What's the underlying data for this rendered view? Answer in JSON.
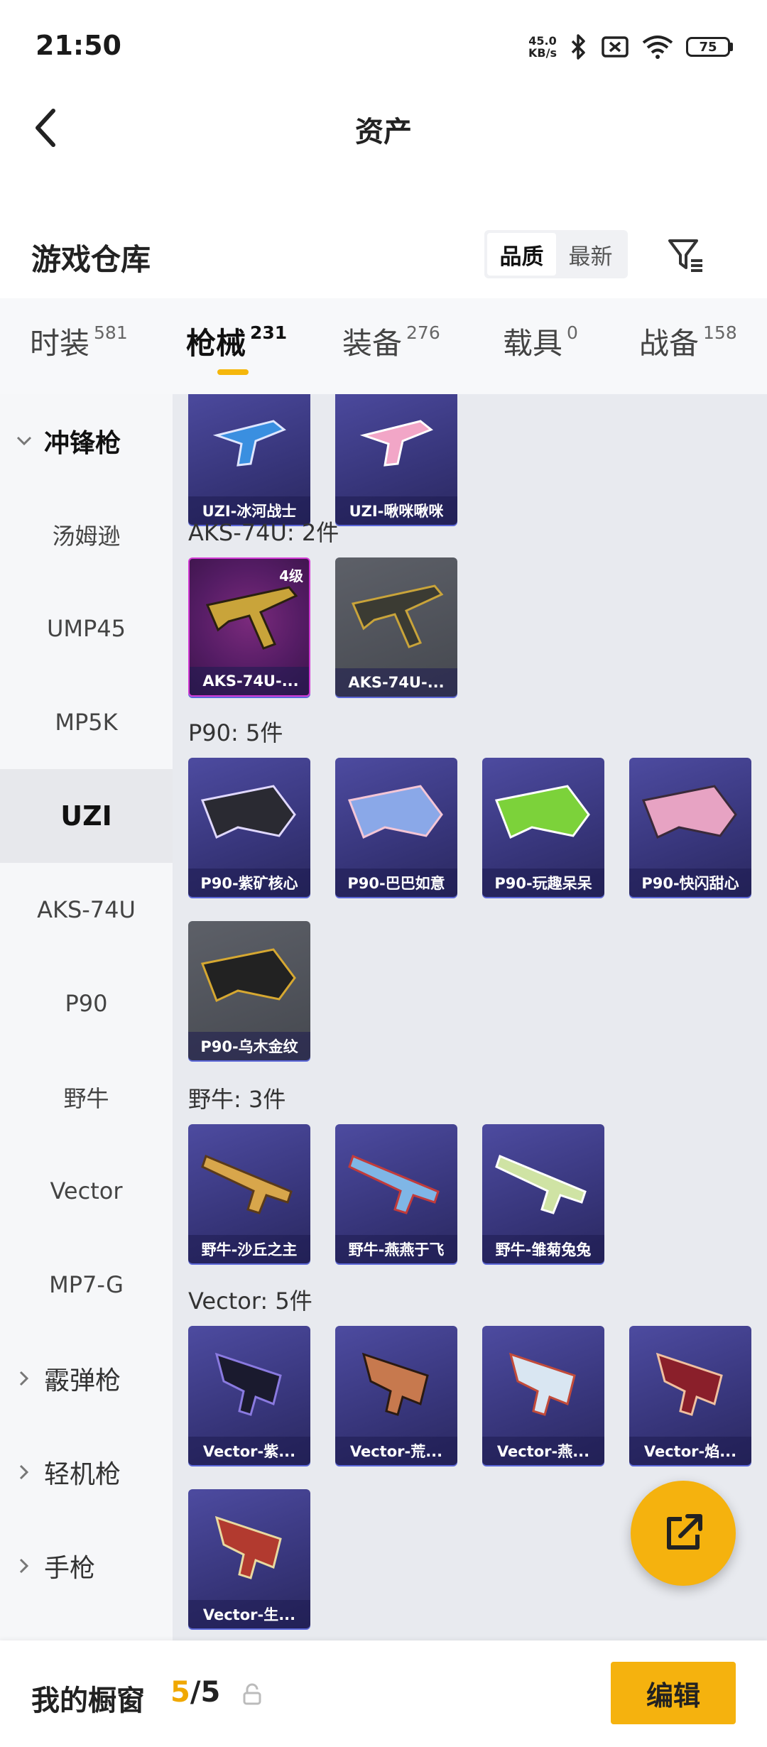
{
  "status_bar": {
    "time": "21:50",
    "net_speed_value": "45.0",
    "net_speed_unit": "KB/s",
    "battery": "75"
  },
  "top_bar": {
    "title": "资产"
  },
  "header": {
    "section_title": "游戏仓库",
    "sort_options": [
      "品质",
      "最新"
    ],
    "sort_active": "品质"
  },
  "tabs": [
    {
      "label": "时装",
      "count": "581"
    },
    {
      "label": "枪械",
      "count": "231",
      "active": true
    },
    {
      "label": "装备",
      "count": "276"
    },
    {
      "label": "载具",
      "count": "0"
    },
    {
      "label": "战备",
      "count": "158"
    }
  ],
  "sidebar": {
    "categories": {
      "smg": "冲锋枪",
      "shotgun": "霰弹枪",
      "lmg": "轻机枪",
      "pistol": "手枪"
    },
    "items": [
      "汤姆逊",
      "UMP45",
      "MP5K",
      "UZI",
      "AKS-74U",
      "P90",
      "野牛",
      "Vector",
      "MP7-G"
    ],
    "active_item": "UZI"
  },
  "content": {
    "partial_row": [
      "UZI-冰河战士",
      "UZI-啾咪啾咪"
    ],
    "groups": [
      {
        "title": "AKS-74U: 2件",
        "items": [
          {
            "name": "AKS-74U-...",
            "style": "pink",
            "level": "4级"
          },
          {
            "name": "AKS-74U-...",
            "style": "gray"
          }
        ]
      },
      {
        "title": "P90: 5件",
        "items": [
          {
            "name": "P90-紫矿核心",
            "style": "purple"
          },
          {
            "name": "P90-巴巴如意",
            "style": "purple"
          },
          {
            "name": "P90-玩趣呆呆",
            "style": "purple"
          },
          {
            "name": "P90-快闪甜心",
            "style": "purple"
          },
          {
            "name": "P90-乌木金纹",
            "style": "gray"
          }
        ]
      },
      {
        "title": "野牛: 3件",
        "items": [
          {
            "name": "野牛-沙丘之主",
            "style": "purple"
          },
          {
            "name": "野牛-燕燕于飞",
            "style": "purple"
          },
          {
            "name": "野牛-雏菊兔兔",
            "style": "purple"
          }
        ]
      },
      {
        "title": "Vector: 5件",
        "items": [
          {
            "name": "Vector-紫...",
            "style": "purple"
          },
          {
            "name": "Vector-荒...",
            "style": "purple"
          },
          {
            "name": "Vector-燕...",
            "style": "purple"
          },
          {
            "name": "Vector-焰...",
            "style": "purple"
          },
          {
            "name": "Vector-生...",
            "style": "purple"
          }
        ]
      }
    ]
  },
  "bottom_bar": {
    "label": "我的橱窗",
    "count_current": "5",
    "count_total": "/5",
    "edit_label": "编辑"
  },
  "colors": {
    "accent": "#f5b20e",
    "card_purple": "#3a387f",
    "card_gray": "#4f5259"
  }
}
